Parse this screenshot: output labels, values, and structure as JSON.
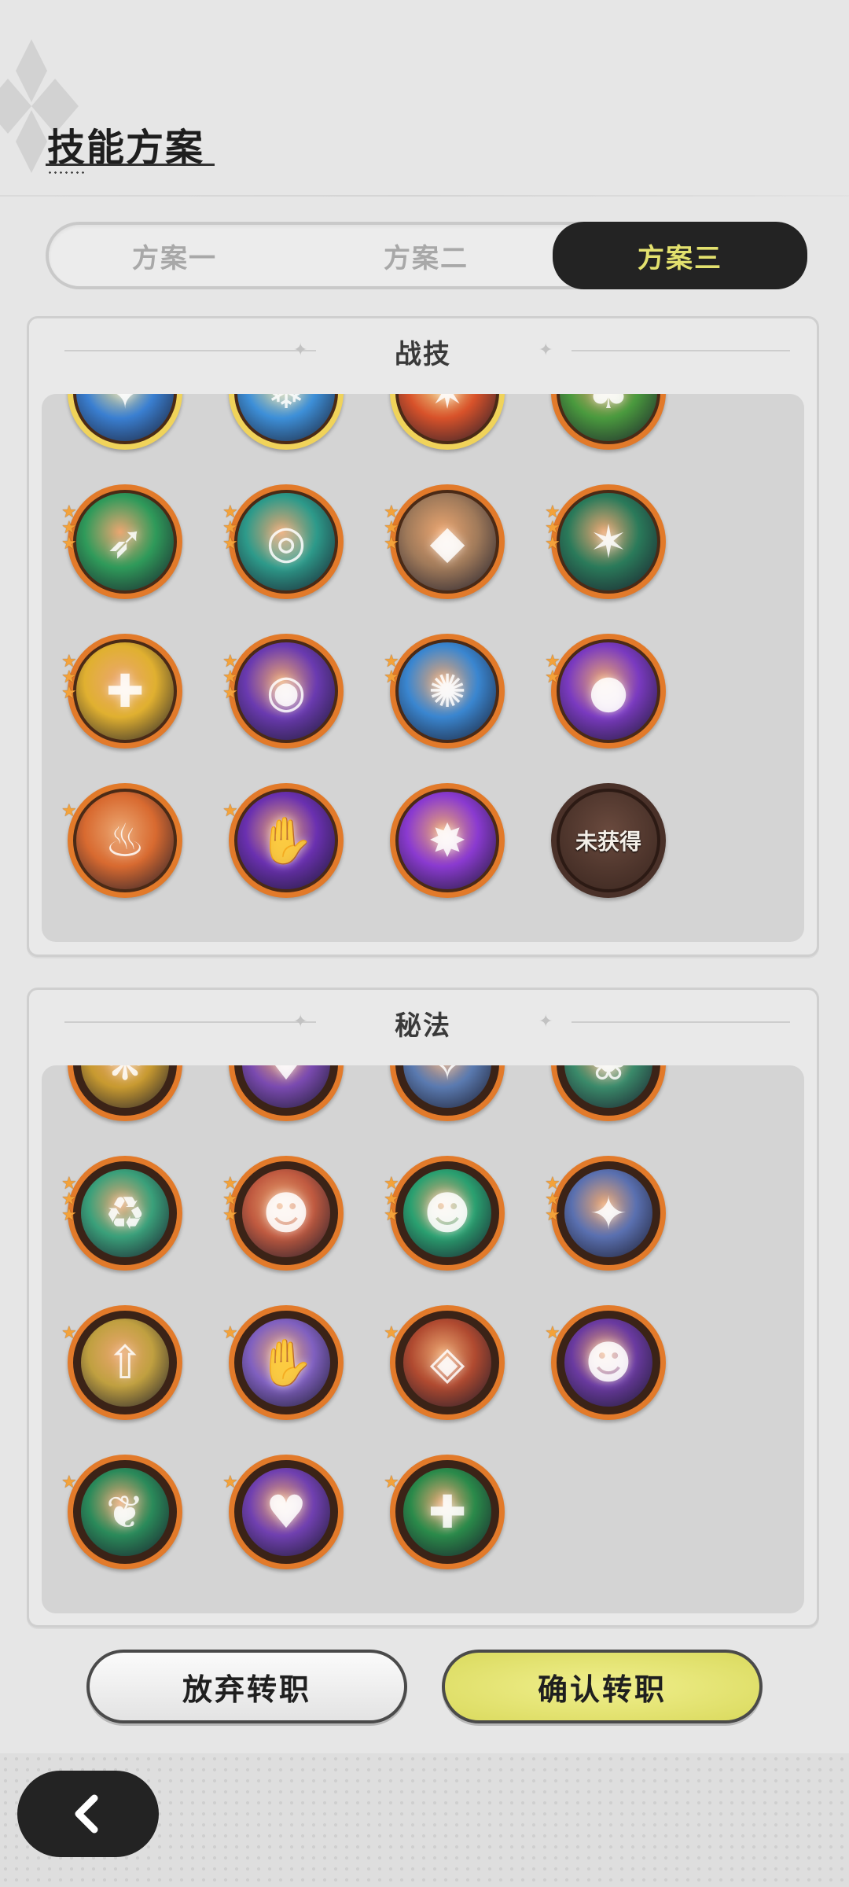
{
  "page": {
    "title": "技能方案"
  },
  "tabs": [
    {
      "label": "方案一",
      "active": false
    },
    {
      "label": "方案二",
      "active": false
    },
    {
      "label": "方案三",
      "active": true
    }
  ],
  "sections": {
    "combat": {
      "title": "战技",
      "skills": [
        {
          "icon": "blue-claw-icon",
          "color": "#3a7fd1",
          "stars": 0,
          "ring": "gold"
        },
        {
          "icon": "ice-crystal-icon",
          "color": "#3d8fd8",
          "stars": 0,
          "ring": "gold"
        },
        {
          "icon": "fire-orb-icon",
          "color": "#d8522a",
          "stars": 0,
          "ring": "gold"
        },
        {
          "icon": "green-tree-icon",
          "color": "#4a9a3e",
          "stars": 1,
          "ring": "orange"
        },
        {
          "icon": "green-feather-icon",
          "color": "#2f9a5a",
          "stars": 3,
          "ring": "orange"
        },
        {
          "icon": "wind-vortex-icon",
          "color": "#2d9a8a",
          "stars": 3,
          "ring": "orange"
        },
        {
          "icon": "rock-shield-icon",
          "color": "#a07a5a",
          "stars": 3,
          "ring": "orange"
        },
        {
          "icon": "thorn-vine-icon",
          "color": "#2a7a5a",
          "stars": 3,
          "ring": "orange"
        },
        {
          "icon": "holy-cross-icon",
          "color": "#e0b030",
          "stars": 3,
          "ring": "orange"
        },
        {
          "icon": "purple-eye-icon",
          "color": "#6a3ab0",
          "stars": 3,
          "ring": "orange"
        },
        {
          "icon": "ice-burst-icon",
          "color": "#3a86d0",
          "stars": 2,
          "ring": "orange"
        },
        {
          "icon": "purple-orb-icon",
          "color": "#7a3ac0",
          "stars": 2,
          "ring": "orange"
        },
        {
          "icon": "fire-wolf-icon",
          "color": "#d86a30",
          "stars": 1,
          "ring": "orange"
        },
        {
          "icon": "purple-hand-icon",
          "color": "#6a30b0",
          "stars": 1,
          "ring": "orange"
        },
        {
          "icon": "purple-star-icon",
          "color": "#8a3ad0",
          "stars": 0,
          "ring": "orange"
        },
        {
          "icon": "locked-skill-icon",
          "color": "#4a3129",
          "stars": 0,
          "ring": "locked",
          "label": "未获得"
        }
      ]
    },
    "secret": {
      "title": "秘法",
      "skills": [
        {
          "icon": "golden-bird-icon",
          "color": "#c89a30",
          "stars": 2
        },
        {
          "icon": "purple-mask-icon",
          "color": "#7a4ab0",
          "stars": 2
        },
        {
          "icon": "sparkle-orb-icon",
          "color": "#5a7ab0",
          "stars": 2
        },
        {
          "icon": "green-clock-icon",
          "color": "#3a8a6a",
          "stars": 2
        },
        {
          "icon": "green-recycle-icon",
          "color": "#3aa07a",
          "stars": 3
        },
        {
          "icon": "red-figure-icon",
          "color": "#c05a40",
          "stars": 3
        },
        {
          "icon": "green-figure-icon",
          "color": "#2aa070",
          "stars": 3
        },
        {
          "icon": "blue-star-icon",
          "color": "#5a70b0",
          "stars": 3
        },
        {
          "icon": "golden-arrows-icon",
          "color": "#c0a040",
          "stars": 1
        },
        {
          "icon": "purple-hand-icon",
          "color": "#8060c0",
          "stars": 1
        },
        {
          "icon": "broken-rock-icon",
          "color": "#b04a30",
          "stars": 1
        },
        {
          "icon": "purple-figure-icon",
          "color": "#6a3aa0",
          "stars": 1
        },
        {
          "icon": "green-wings-icon",
          "color": "#2a8a5a",
          "stars": 1
        },
        {
          "icon": "purple-heart-icon",
          "color": "#7040b0",
          "stars": 1
        },
        {
          "icon": "green-sparkle-icon",
          "color": "#2a8a4a",
          "stars": 1
        }
      ]
    }
  },
  "buttons": {
    "cancel": "放弃转职",
    "confirm": "确认转职"
  },
  "nav": {
    "back_icon": "chevron-left-icon"
  }
}
